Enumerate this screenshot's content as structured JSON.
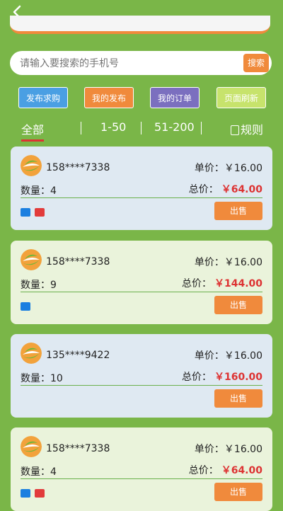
{
  "search": {
    "placeholder": "请输入要搜索的手机号",
    "button": "搜索"
  },
  "actions": [
    "发布求购",
    "我的发布",
    "我的订单",
    "页面刷新"
  ],
  "tabs": [
    "全部",
    "1-50",
    "51-200",
    "规则"
  ],
  "cards": [
    {
      "phone": "158****7338",
      "qty_label": "数量：",
      "qty": "4",
      "unit_label": "单价：",
      "unit_price": "￥16.00",
      "total_label": "总价：",
      "total": "￥64.00",
      "sell": "出售",
      "pay_icons": [
        "alipay-icon",
        "unionpay-icon"
      ]
    },
    {
      "phone": "158****7338",
      "qty_label": "数量：",
      "qty": "9",
      "unit_label": "单价：",
      "unit_price": "￥16.00",
      "total_label": "总价：",
      "total": "￥144.00",
      "sell": "出售",
      "pay_icons": [
        "alipay-icon"
      ]
    },
    {
      "phone": "135****9422",
      "qty_label": "数量：",
      "qty": "10",
      "unit_label": "单价：",
      "unit_price": "￥16.00",
      "total_label": "总价：",
      "total": "￥160.00",
      "sell": "出售",
      "pay_icons": []
    },
    {
      "phone": "158****7338",
      "qty_label": "数量：",
      "qty": "4",
      "unit_label": "单价：",
      "unit_price": "￥16.00",
      "total_label": "总价：",
      "total": "￥64.00",
      "sell": "出售",
      "pay_icons": [
        "alipay-icon",
        "unionpay-icon"
      ]
    }
  ]
}
